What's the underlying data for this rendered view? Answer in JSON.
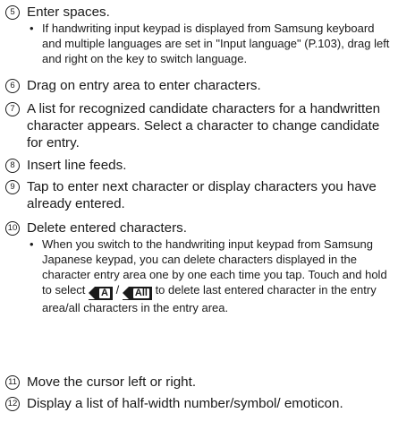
{
  "items": [
    {
      "marker": "5",
      "text": "Enter spaces.",
      "note": "If handwriting input keypad is displayed from Samsung keyboard and multiple languages are set in \"Input language\" (P.103), drag left and right on the key to switch language."
    },
    {
      "marker": "6",
      "text": "Drag on entry area to enter characters."
    },
    {
      "marker": "7",
      "text": "A list for recognized candidate characters for a handwritten character appears. Select a character to change candidate for entry."
    },
    {
      "marker": "8",
      "text": "Insert line feeds."
    },
    {
      "marker": "9",
      "text": "Tap to enter next character or display characters you have already entered."
    },
    {
      "marker": "10",
      "text": "Delete entered characters.",
      "note_part1": "When you switch to the handwriting input keypad from Samsung Japanese keypad, you can delete characters displayed in the character entry area one by one each time you tap. Touch and hold to select",
      "key_a": "A",
      "separator": "/",
      "key_all": "All",
      "note_part2": "to delete last entered character in the entry area/all characters in the entry area."
    },
    {
      "marker": "11",
      "text": "Move the cursor left or right."
    },
    {
      "marker": "12",
      "text": "Display a list of half-width number/symbol/ emoticon."
    }
  ],
  "bullet_glyph": "•"
}
